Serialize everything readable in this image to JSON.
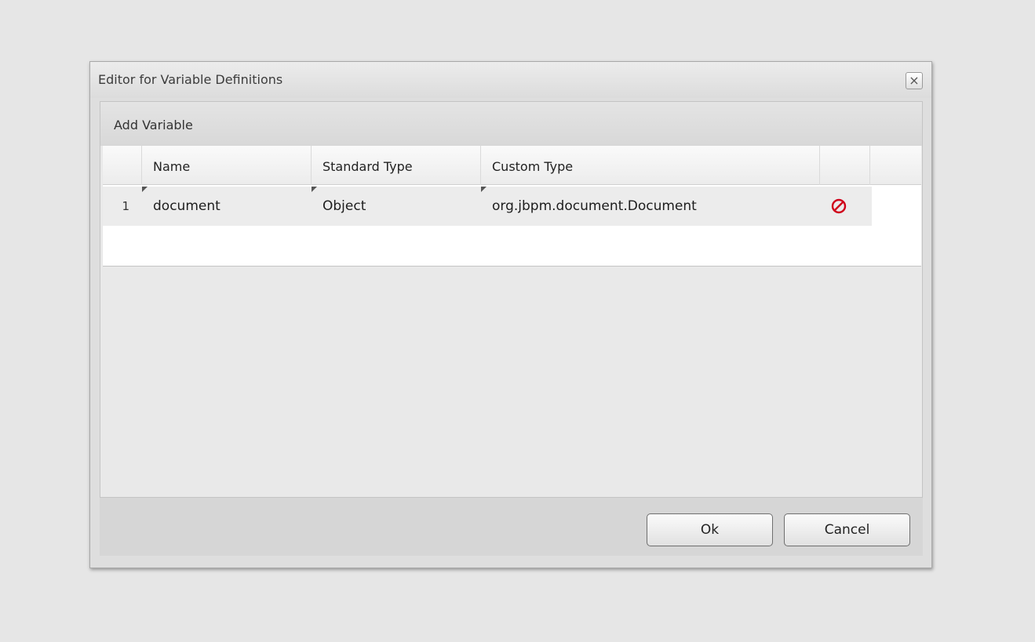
{
  "dialog": {
    "title": "Editor for Variable Definitions",
    "close_icon": "close-icon",
    "toolbar": {
      "add_variable_label": "Add Variable"
    },
    "grid": {
      "columns": [
        "Name",
        "Standard Type",
        "Custom Type"
      ],
      "rows": [
        {
          "index": "1",
          "name": "document",
          "standard_type": "Object",
          "custom_type": "org.jbpm.document.Document",
          "delete_icon": "delete-icon"
        }
      ]
    },
    "buttons": {
      "ok": "Ok",
      "cancel": "Cancel"
    }
  },
  "colors": {
    "background": "#e6e6e6",
    "delete_icon": "#d0021b"
  }
}
